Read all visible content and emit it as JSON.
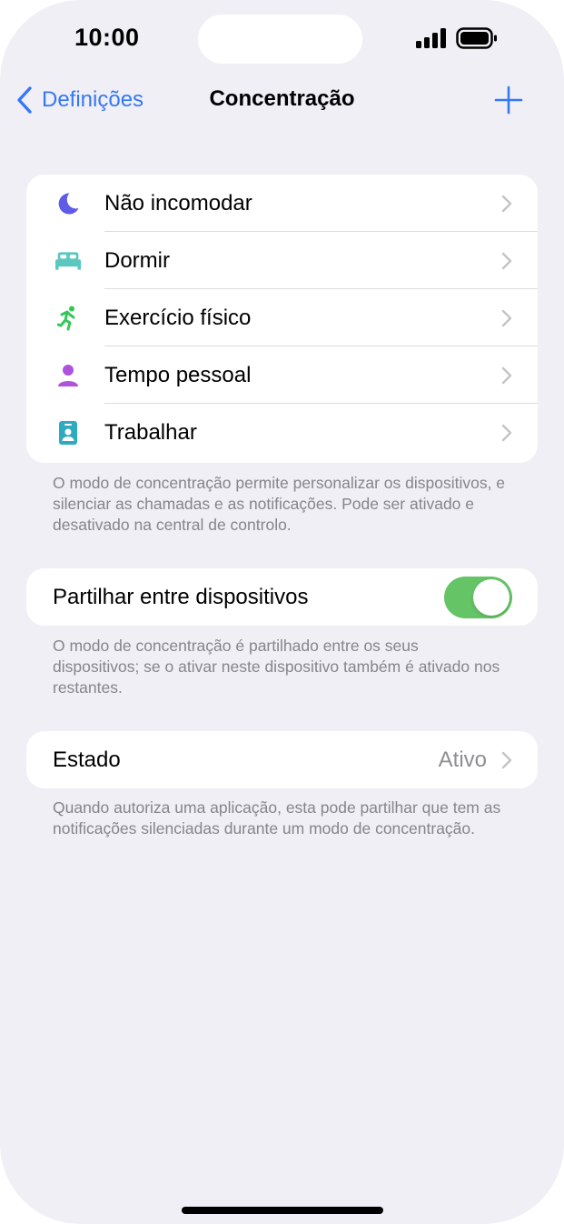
{
  "status": {
    "time": "10:00"
  },
  "nav": {
    "back_label": "Definições",
    "title": "Concentração"
  },
  "focus_modes": [
    {
      "label": "Não incomodar",
      "icon": "moon-icon",
      "color": "#5e5ce6"
    },
    {
      "label": "Dormir",
      "icon": "bed-icon",
      "color": "#5ac8be"
    },
    {
      "label": "Exercício físico",
      "icon": "runner-icon",
      "color": "#34c759"
    },
    {
      "label": "Tempo pessoal",
      "icon": "person-icon",
      "color": "#af52de"
    },
    {
      "label": "Trabalhar",
      "icon": "id-badge-icon",
      "color": "#30aac0"
    }
  ],
  "focus_footer": "O modo de concentração permite personalizar os dispositivos, e silenciar as chamadas e as notificações. Pode ser ativado e desativado na central de controlo.",
  "share": {
    "label": "Partilhar entre dispositivos",
    "enabled": true,
    "toggle_color": "#65c466"
  },
  "share_footer": "O modo de concentração é partilhado entre os seus dispositivos; se o ativar neste dispositivo também é ativado nos restantes.",
  "status_row": {
    "label": "Estado",
    "value": "Ativo"
  },
  "status_footer": "Quando autoriza uma aplicação, esta pode partilhar que tem as notificações silenciadas durante um modo de concentração.",
  "accent_color": "#3478f6"
}
